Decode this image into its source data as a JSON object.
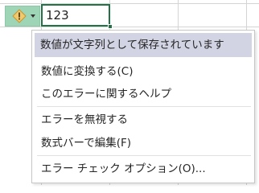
{
  "cell": {
    "value": "123"
  },
  "colors": {
    "accent": "#217346",
    "smart_tag_bg": "#9fd5b7",
    "menu_highlight": "#d2d4e4",
    "warning_icon": "#d9a441"
  },
  "error_smart_tag": {
    "icon": "warning-diamond-icon",
    "arrow_icon": "chevron-down-icon"
  },
  "menu": {
    "header": "数値が文字列として保存されています",
    "items": [
      {
        "label": "数値に変換する(C)"
      },
      {
        "label": "このエラーに関するヘルプ"
      },
      {
        "label": "エラーを無視する"
      },
      {
        "label": "数式バーで編集(F)"
      },
      {
        "label": "エラー チェック オプション(O)..."
      }
    ]
  }
}
